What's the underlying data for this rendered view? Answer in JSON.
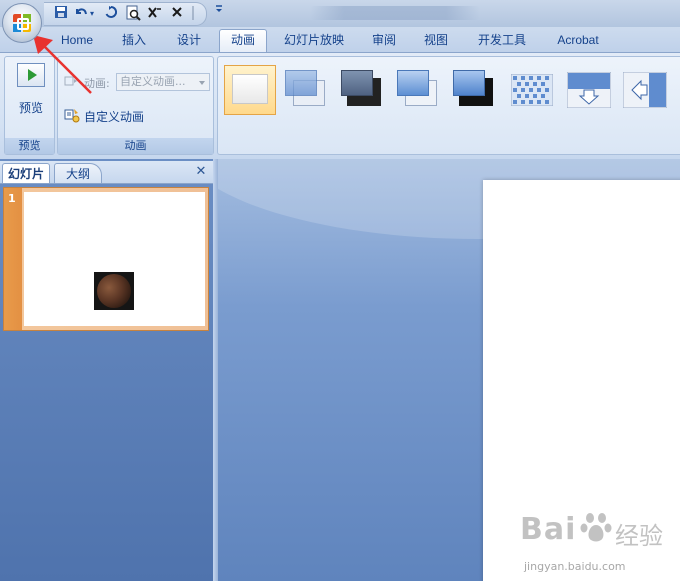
{
  "qat": {
    "icons": [
      "save-icon",
      "undo-icon",
      "redo-icon",
      "print-preview-icon",
      "spelling-icon",
      "close-icon",
      "customize-icon"
    ]
  },
  "tabs": [
    {
      "label": "Home"
    },
    {
      "label": "插入"
    },
    {
      "label": "设计"
    },
    {
      "label": "动画",
      "active": true
    },
    {
      "label": "幻灯片放映"
    },
    {
      "label": "审阅"
    },
    {
      "label": "视图"
    },
    {
      "label": "开发工具"
    },
    {
      "label": "Acrobat"
    }
  ],
  "ribbon": {
    "preview_group": {
      "button_label": "预览",
      "group_label": "预览"
    },
    "animation_group": {
      "animation_label": "动画:",
      "animation_select_value": "自定义动画...",
      "custom_animation_label": "自定义动画",
      "group_label": "动画"
    }
  },
  "panel": {
    "tab_slides": "幻灯片",
    "tab_outline": "大纲",
    "close_symbol": "✕",
    "slides": [
      {
        "number": "1"
      }
    ]
  },
  "watermark": {
    "brand": "Bai",
    "brand_suffix": "经验",
    "url": "jingyan.baidu.com"
  },
  "colors": {
    "annotation_arrow": "#e8322f",
    "accent": "#15428b"
  }
}
